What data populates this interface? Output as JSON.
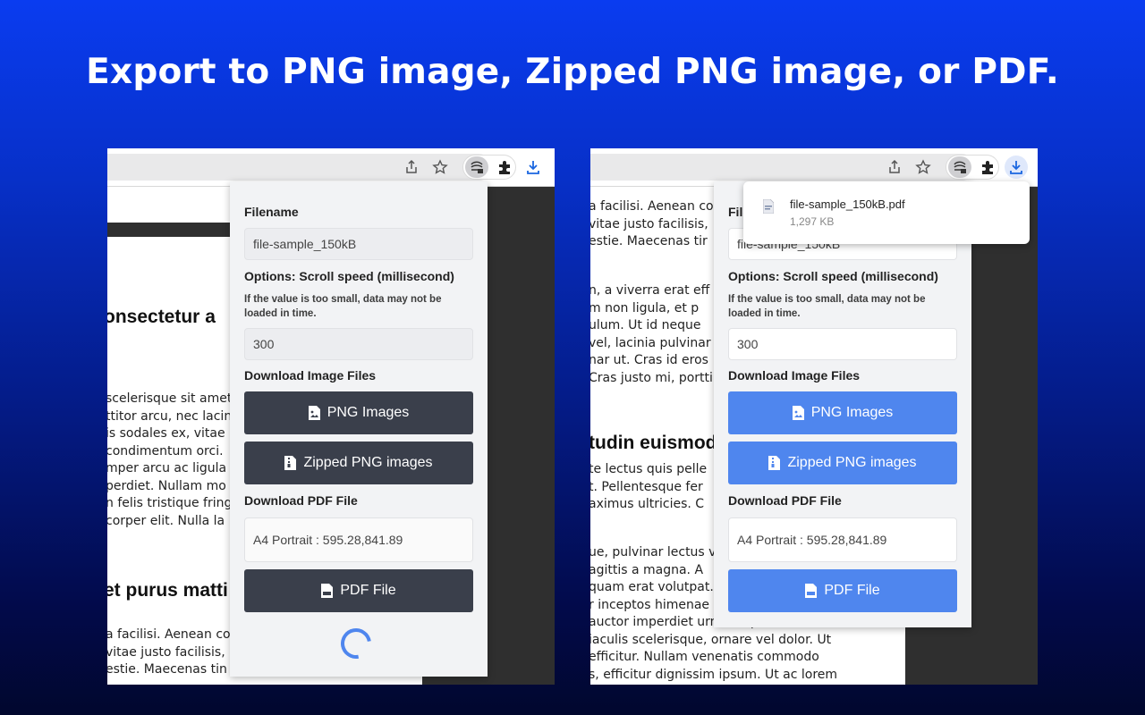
{
  "headline": "Export to PNG image, Zipped PNG image, or PDF.",
  "colors": {
    "dark_button": "#3a3f4b",
    "blue_button": "#4f86ee",
    "popup_bg": "#f2f3f5"
  },
  "toolbar_icons": [
    "share-icon",
    "star-icon",
    "extension-icon",
    "puzzle-icon",
    "download-icon"
  ],
  "left": {
    "page": {
      "heading1": "onsectetur a",
      "para1": [
        "scelerisque sit amet",
        "ttitor arcu, nec lacin",
        "is sodales ex, vitae",
        "condimentum orci.",
        "mper arcu ac ligula",
        "perdiet. Nullam mo",
        "n felis tristique fring",
        "corper elit. Nulla la"
      ],
      "heading2": "et purus matti",
      "para2": [
        "a facilisi. Aenean co",
        "vitae justo facilisis,",
        "estie. Maecenas tin"
      ]
    },
    "popup": {
      "filename_label": "Filename",
      "filename_value": "file-sample_150kB",
      "options_label": "Options: Scroll speed (millisecond)",
      "options_note": "If the value is too small, data may not be loaded in time.",
      "scroll_value": "300",
      "image_section_label": "Download Image Files",
      "png_button": "PNG Images",
      "zip_button": "Zipped PNG images",
      "pdf_section_label": "Download PDF File",
      "pdf_format_value": "A4 Portrait : 595.28,841.89",
      "pdf_button": "PDF File"
    }
  },
  "right": {
    "page": {
      "para0": [
        "a facilisi. Aenean co",
        "vitae justo facilisis,",
        "estie. Maecenas tir"
      ],
      "para1": [
        "n, a viverra erat eff",
        "m non ligula, et p",
        "ulum. Ut id neque",
        "vel, lacinia pulvinar",
        "nar ut. Cras id eros",
        "Cras justo mi, portti"
      ],
      "heading1": "tudin euismod",
      "para2": [
        "te lectus quis pelle",
        "t. Pellentesque fer",
        "aximus ultricies. C"
      ],
      "para3": [
        "ue, pulvinar lectus v",
        "agittis a magna. A",
        "quam erat volutpat.",
        "r inceptos himenae",
        "auctor imperdiet urna, ut pulvinar leo",
        "iaculis scelerisque, ornare vel dolor. Ut",
        "efficitur. Nullam venenatis commodo",
        "s, efficitur dignissim ipsum. Ut ac lorem"
      ]
    },
    "popup": {
      "filename_label": "Filename",
      "filename_value": "file-sample_150kB",
      "options_label": "Options: Scroll speed (millisecond)",
      "options_note": "If the value is too small, data may not be loaded in time.",
      "scroll_value": "300",
      "image_section_label": "Download Image Files",
      "png_button": "PNG Images",
      "zip_button": "Zipped PNG images",
      "pdf_section_label": "Download PDF File",
      "pdf_format_value": "A4 Portrait : 595.28,841.89",
      "pdf_button": "PDF File"
    },
    "download": {
      "file_name": "file-sample_150kB.pdf",
      "file_size": "1,297 KB"
    }
  }
}
